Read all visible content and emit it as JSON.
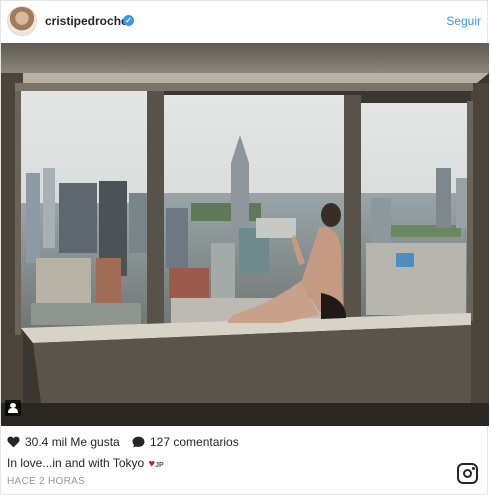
{
  "header": {
    "username": "cristipedroche",
    "verified_icon": "verified-badge-icon",
    "follow_label": "Seguir"
  },
  "photo": {
    "user_tag_icon": "user-tag-icon"
  },
  "stats": {
    "likes": "30.4 mil Me gusta",
    "comments": "127 comentarios"
  },
  "caption": {
    "text": "In love...in and with Tokyo",
    "flag": "JP"
  },
  "timestamp": "HACE 2 HORAS",
  "colors": {
    "accent": "#3897f0",
    "text": "#262626",
    "muted": "#999999"
  }
}
